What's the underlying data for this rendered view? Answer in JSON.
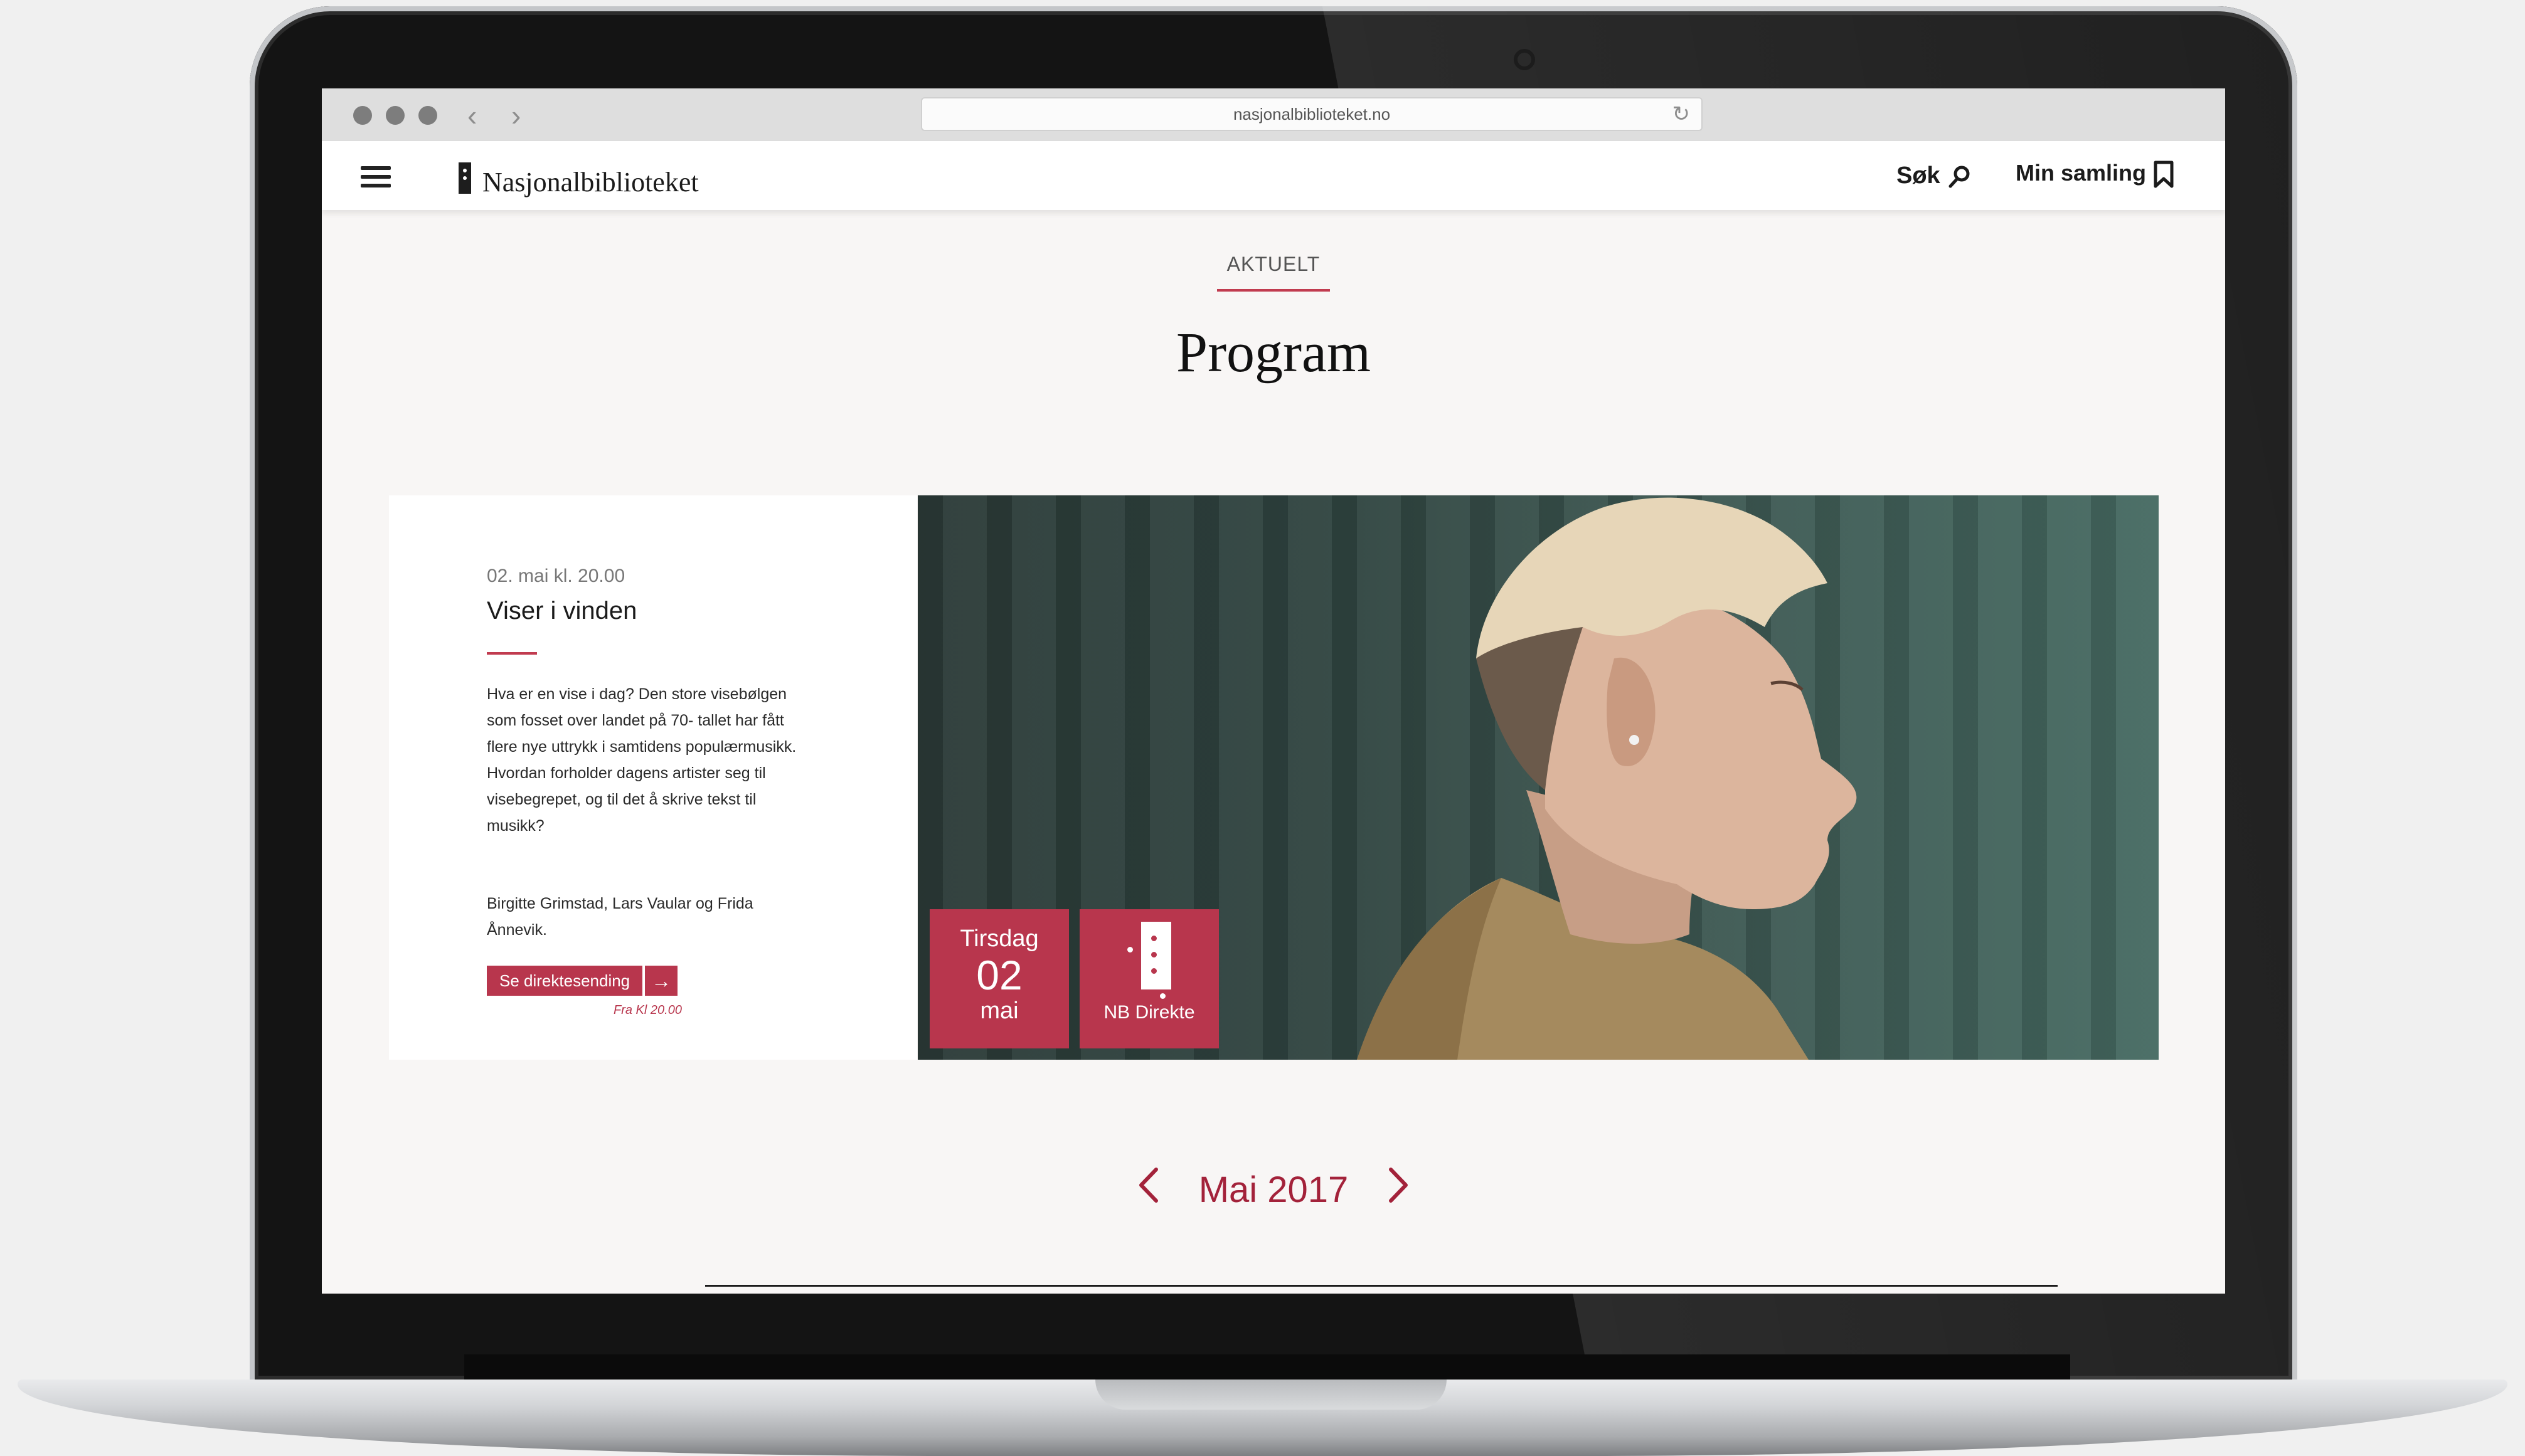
{
  "browser": {
    "url": "nasjonalbiblioteket.no"
  },
  "header": {
    "logo_text": "Nasjonalbiblioteket",
    "search_label": "Søk",
    "collection_label": "Min samling"
  },
  "page": {
    "kicker": "AKTUELT",
    "title": "Program"
  },
  "event": {
    "datetime": "02. mai kl. 20.00",
    "title": "Viser i vinden",
    "description": "Hva er en vise i dag? Den store visebølgen som fosset over landet på 70- tallet har fått flere nye uttrykk i samtidens populærmusikk. Hvordan forholder dagens artister seg til visebegrepet, og til det å skrive tekst til musikk?",
    "performers": "Birgitte Grimstad, Lars Vaular og Frida Ånnevik.",
    "button_label": "Se direktesending",
    "button_note": "Fra Kl 20.00",
    "date_tile": {
      "day_name": "Tirsdag",
      "day_number": "02",
      "month": "mai"
    },
    "channel_tile": {
      "label": "NB Direkte"
    }
  },
  "calendar": {
    "month_label": "Mai 2017"
  },
  "colors": {
    "accent": "#b8364d",
    "accent_dark": "#a3223a",
    "background": "#f8f6f5"
  }
}
